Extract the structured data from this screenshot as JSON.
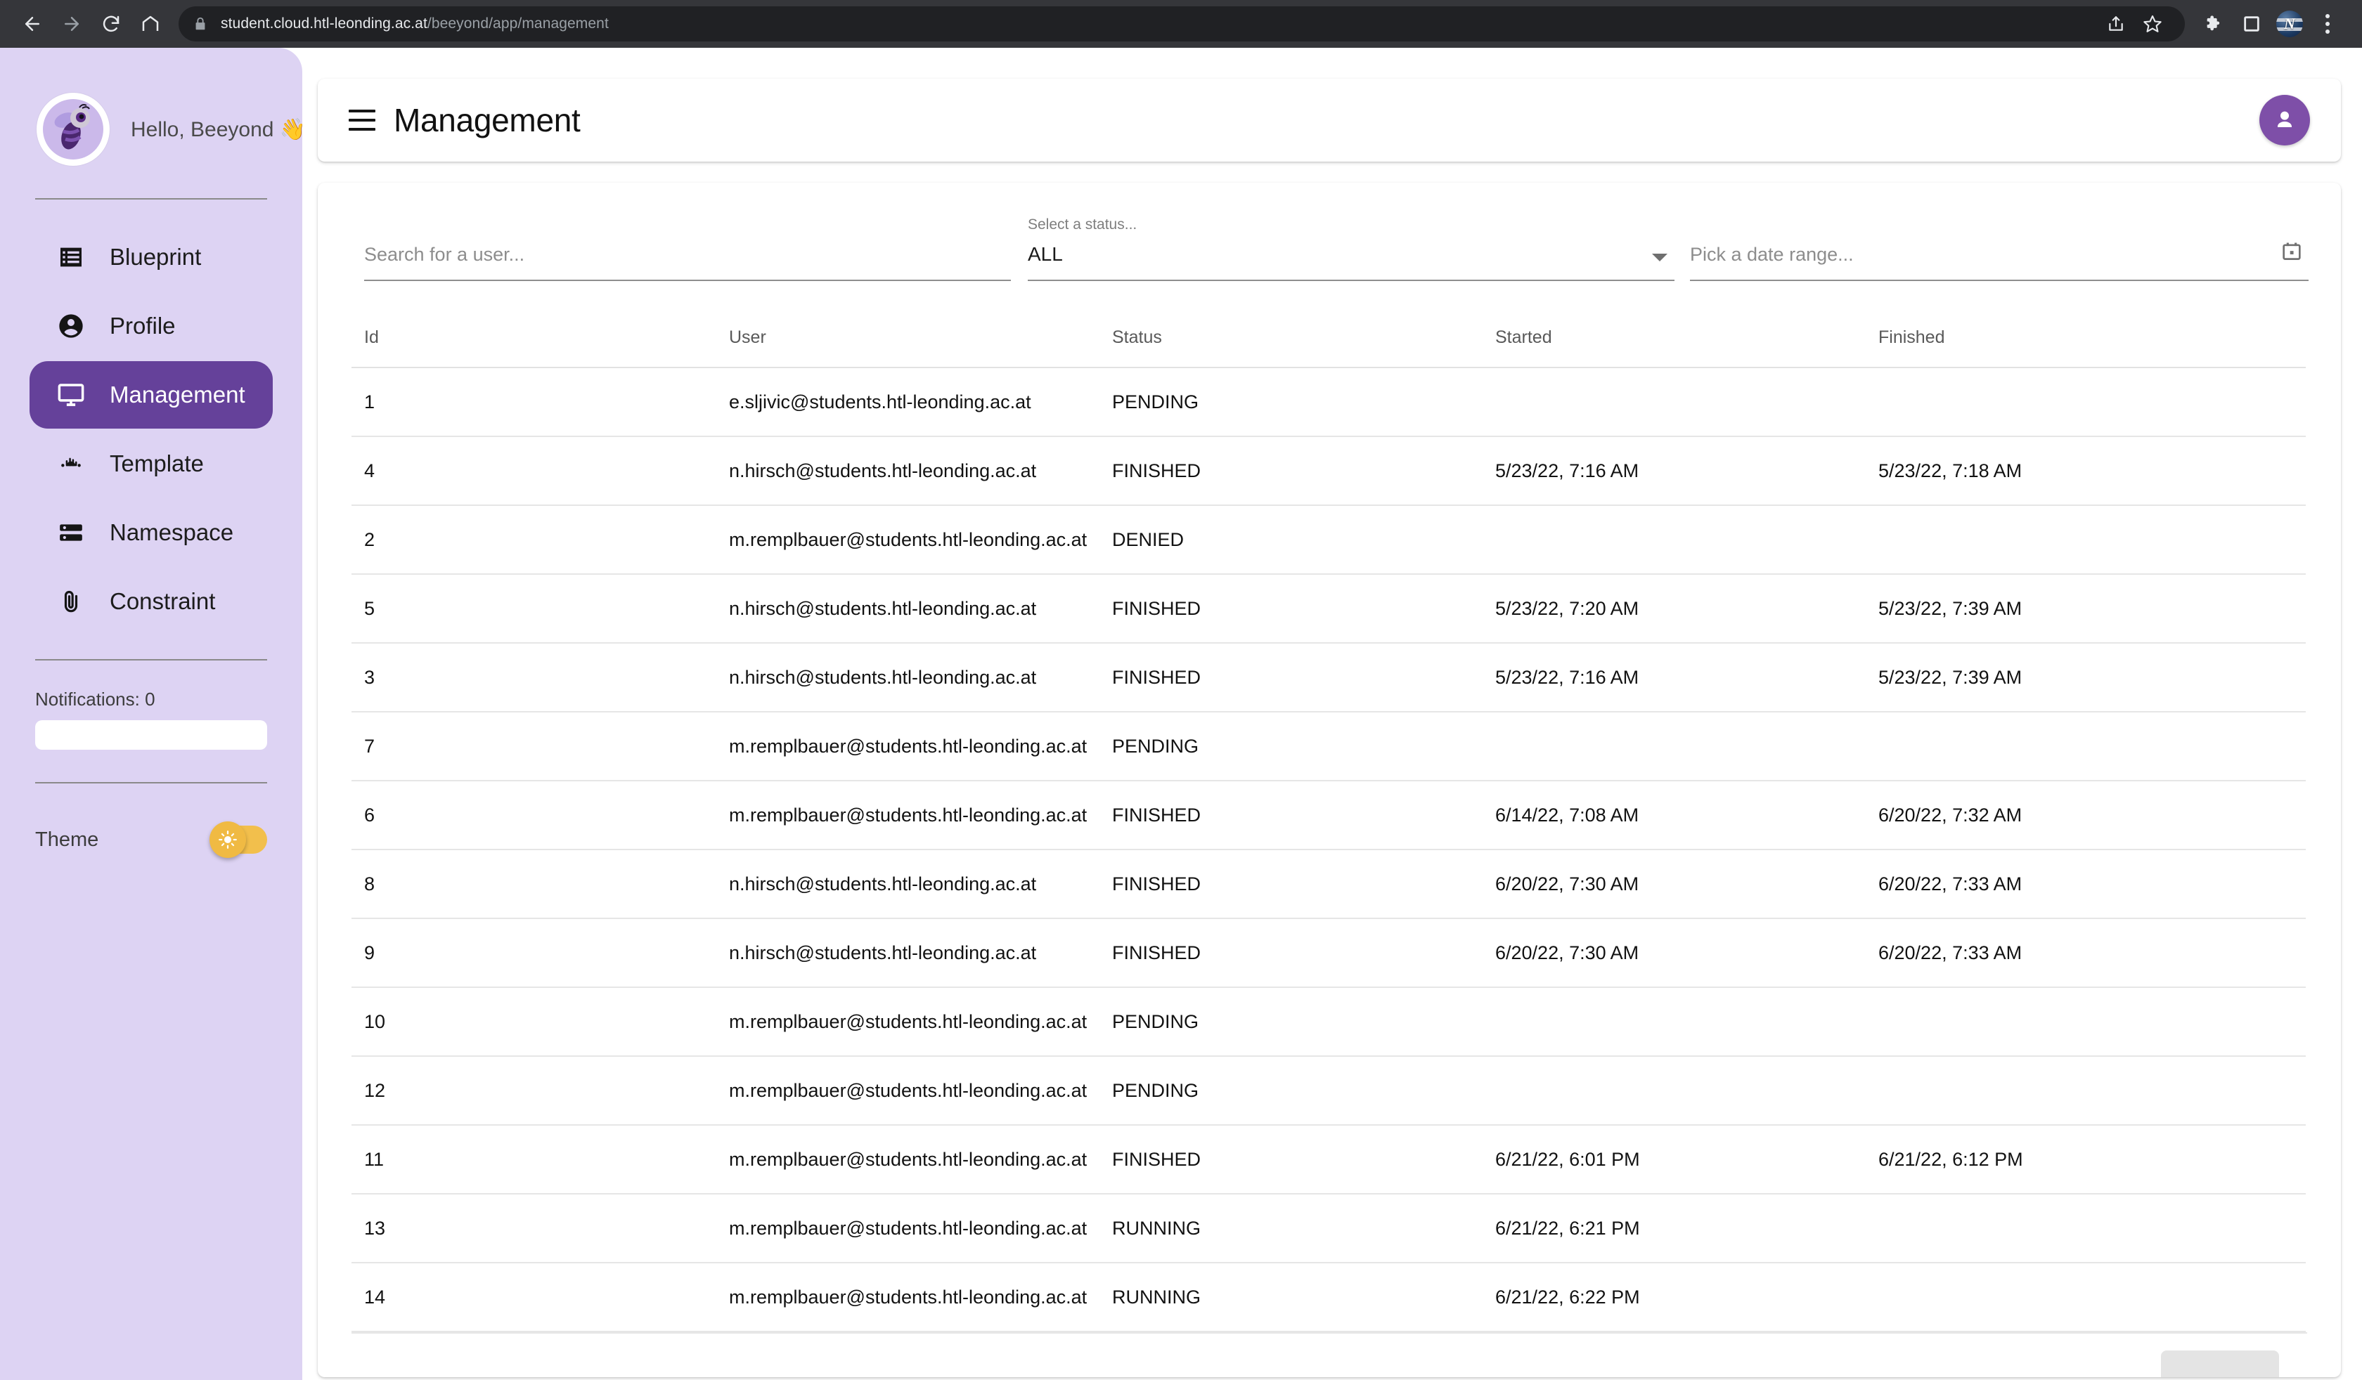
{
  "browser": {
    "back_icon": "back-arrow-icon",
    "forward_icon": "forward-arrow-icon",
    "reload_icon": "reload-icon",
    "home_icon": "home-icon",
    "lock_icon": "lock-icon",
    "url_domain": "student.cloud.htl-leonding.ac.at",
    "url_path": "/beeyond/app/management",
    "share_icon": "share-icon",
    "bookmark_icon": "star-icon",
    "extensions_icon": "puzzle-icon",
    "side_panel_icon": "side-panel-icon",
    "profile_initial": "N",
    "menu_icon": "three-dot-menu-icon"
  },
  "sidebar": {
    "greeting": "Hello, Beeyond 👋",
    "avatar_icon": "bee-avatar",
    "items": [
      {
        "label": "Blueprint",
        "icon": "list-icon",
        "active": false
      },
      {
        "label": "Profile",
        "icon": "account-circle-icon",
        "active": false
      },
      {
        "label": "Management",
        "icon": "monitor-icon",
        "active": true
      },
      {
        "label": "Template",
        "icon": "blur-on-icon",
        "active": false
      },
      {
        "label": "Namespace",
        "icon": "storage-icon",
        "active": false
      },
      {
        "label": "Constraint",
        "icon": "paperclip-icon",
        "active": false
      }
    ],
    "notifications_label": "Notifications: 0",
    "theme_label": "Theme",
    "theme_toggle_icon": "sun-icon",
    "theme_toggle_on": true,
    "accent_color": "#65419a",
    "background_color": "#ddd3f3",
    "toggle_color": "#f0ba43"
  },
  "header": {
    "menu_icon": "hamburger-menu-icon",
    "title": "Management",
    "avatar_icon": "account-circle-icon",
    "avatar_color": "#7e4fa8"
  },
  "filters": {
    "search_placeholder": "Search for a user...",
    "status_label": "Select a status...",
    "status_value": "ALL",
    "status_arrow_icon": "chevron-down-icon",
    "date_placeholder": "Pick a date range...",
    "calendar_icon": "calendar-icon"
  },
  "table": {
    "columns": [
      "Id",
      "User",
      "Status",
      "Started",
      "Finished"
    ],
    "rows": [
      {
        "id": "1",
        "user": "e.sljivic@students.htl-leonding.ac.at",
        "status": "PENDING",
        "started": "",
        "finished": ""
      },
      {
        "id": "4",
        "user": "n.hirsch@students.htl-leonding.ac.at",
        "status": "FINISHED",
        "started": "5/23/22, 7:16 AM",
        "finished": "5/23/22, 7:18 AM"
      },
      {
        "id": "2",
        "user": "m.remplbauer@students.htl-leonding.ac.at",
        "status": "DENIED",
        "started": "",
        "finished": ""
      },
      {
        "id": "5",
        "user": "n.hirsch@students.htl-leonding.ac.at",
        "status": "FINISHED",
        "started": "5/23/22, 7:20 AM",
        "finished": "5/23/22, 7:39 AM"
      },
      {
        "id": "3",
        "user": "n.hirsch@students.htl-leonding.ac.at",
        "status": "FINISHED",
        "started": "5/23/22, 7:16 AM",
        "finished": "5/23/22, 7:39 AM"
      },
      {
        "id": "7",
        "user": "m.remplbauer@students.htl-leonding.ac.at",
        "status": "PENDING",
        "started": "",
        "finished": ""
      },
      {
        "id": "6",
        "user": "m.remplbauer@students.htl-leonding.ac.at",
        "status": "FINISHED",
        "started": "6/14/22, 7:08 AM",
        "finished": "6/20/22, 7:32 AM"
      },
      {
        "id": "8",
        "user": "n.hirsch@students.htl-leonding.ac.at",
        "status": "FINISHED",
        "started": "6/20/22, 7:30 AM",
        "finished": "6/20/22, 7:33 AM"
      },
      {
        "id": "9",
        "user": "n.hirsch@students.htl-leonding.ac.at",
        "status": "FINISHED",
        "started": "6/20/22, 7:30 AM",
        "finished": "6/20/22, 7:33 AM"
      },
      {
        "id": "10",
        "user": "m.remplbauer@students.htl-leonding.ac.at",
        "status": "PENDING",
        "started": "",
        "finished": ""
      },
      {
        "id": "12",
        "user": "m.remplbauer@students.htl-leonding.ac.at",
        "status": "PENDING",
        "started": "",
        "finished": ""
      },
      {
        "id": "11",
        "user": "m.remplbauer@students.htl-leonding.ac.at",
        "status": "FINISHED",
        "started": "6/21/22, 6:01 PM",
        "finished": "6/21/22, 6:12 PM"
      },
      {
        "id": "13",
        "user": "m.remplbauer@students.htl-leonding.ac.at",
        "status": "RUNNING",
        "started": "6/21/22, 6:21 PM",
        "finished": ""
      },
      {
        "id": "14",
        "user": "m.remplbauer@students.htl-leonding.ac.at",
        "status": "RUNNING",
        "started": "6/21/22, 6:22 PM",
        "finished": ""
      }
    ]
  }
}
